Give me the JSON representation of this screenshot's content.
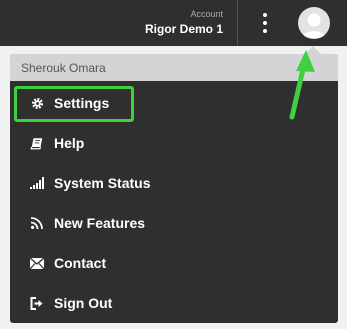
{
  "topbar": {
    "account_label": "Account",
    "account_name": "Rigor Demo 1",
    "menu_icon": "kebab-menu-icon",
    "avatar_icon": "user-avatar-icon",
    "background": "#2f2f2f"
  },
  "menu": {
    "user_name": "Sherouk Omara",
    "items": [
      {
        "label": "Settings",
        "icon": "gear-icon"
      },
      {
        "label": "Help",
        "icon": "book-icon"
      },
      {
        "label": "System Status",
        "icon": "signal-bars-icon"
      },
      {
        "label": "New Features",
        "icon": "rss-icon"
      },
      {
        "label": "Contact",
        "icon": "envelope-icon"
      },
      {
        "label": "Sign Out",
        "icon": "sign-out-icon"
      }
    ]
  },
  "annotations": {
    "highlight_color": "#3fd03f",
    "arrow_color": "#3fd03f"
  }
}
